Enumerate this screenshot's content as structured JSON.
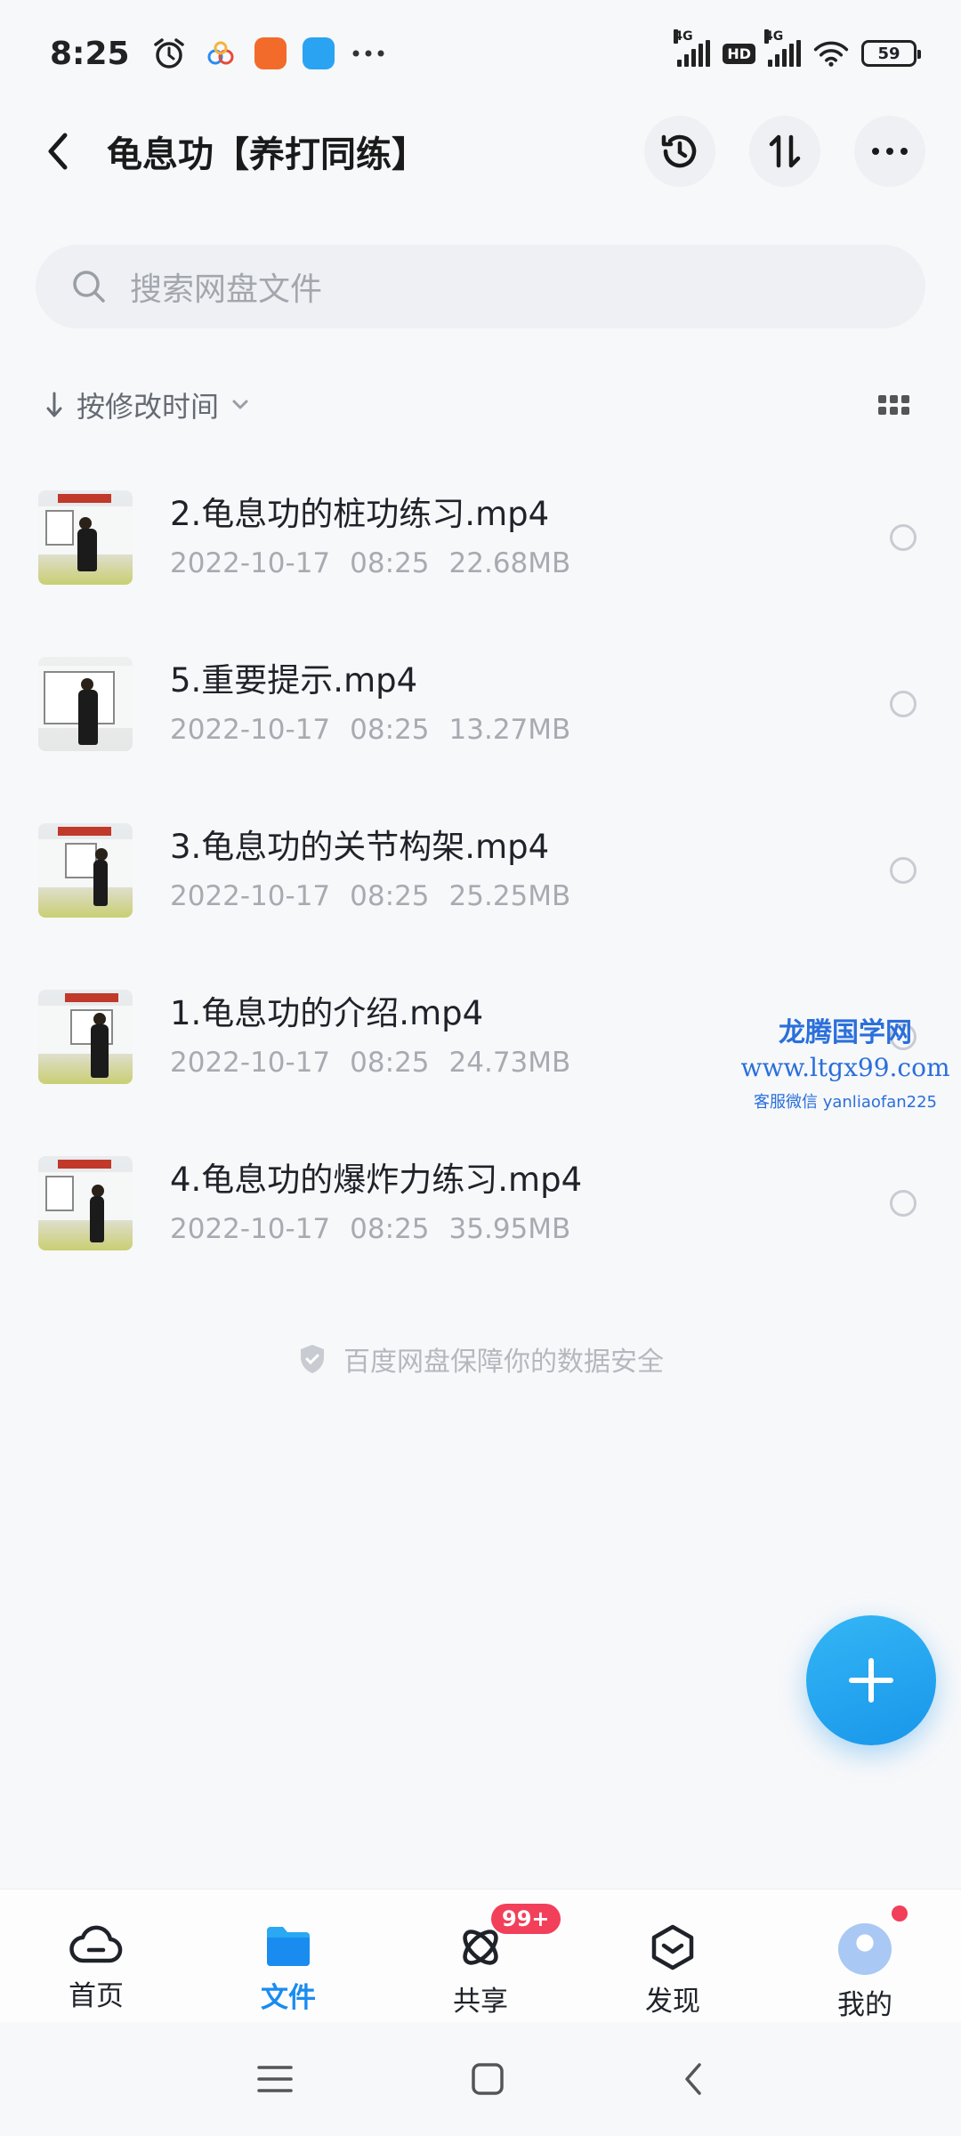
{
  "status_bar": {
    "time": "8:25",
    "network_1": "4G",
    "hd": "HD",
    "network_2": "4G",
    "battery": "59"
  },
  "header": {
    "title": "龟息功【养打同练】",
    "icons": [
      "back-icon",
      "history-icon",
      "transfer-icon",
      "more-icon"
    ]
  },
  "search": {
    "placeholder": "搜索网盘文件"
  },
  "sort": {
    "label": "按修改时间"
  },
  "files": [
    {
      "name": "2.龟息功的桩功练习.mp4",
      "date": "2022-10-17",
      "time": "08:25",
      "size": "22.68MB"
    },
    {
      "name": "5.重要提示.mp4",
      "date": "2022-10-17",
      "time": "08:25",
      "size": "13.27MB"
    },
    {
      "name": "3.龟息功的关节构架.mp4",
      "date": "2022-10-17",
      "time": "08:25",
      "size": "25.25MB"
    },
    {
      "name": "1.龟息功的介绍.mp4",
      "date": "2022-10-17",
      "time": "08:25",
      "size": "24.73MB"
    },
    {
      "name": "4.龟息功的爆炸力练习.mp4",
      "date": "2022-10-17",
      "time": "08:25",
      "size": "35.95MB"
    }
  ],
  "watermark": {
    "title": "龙腾国学网",
    "url": "www.ltgx99.com",
    "contact": "客服微信 yanliaofan225"
  },
  "security_note": "百度网盘保障你的数据安全",
  "tabs": [
    {
      "label": "首页",
      "icon": "cloud-icon"
    },
    {
      "label": "文件",
      "icon": "folder-icon"
    },
    {
      "label": "共享",
      "icon": "share-icon"
    },
    {
      "label": "发现",
      "icon": "discover-icon"
    },
    {
      "label": "我的",
      "icon": "avatar"
    }
  ],
  "share_badge": "99+",
  "colors": {
    "accent": "#1a8cf0",
    "fab": "#1896ea",
    "badge": "#f23f5a",
    "watermark": "#2a6fdb"
  }
}
